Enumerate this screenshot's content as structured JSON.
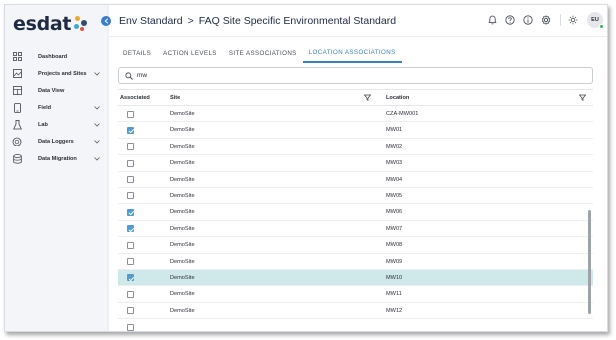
{
  "brand": {
    "name": "esdat",
    "dot_colors": [
      "#f5a623",
      "#2c4a7a",
      "#3aa8d8",
      "#e8523b"
    ]
  },
  "sidebar": {
    "items": [
      {
        "label": "Dashboard",
        "icon": "grid-icon",
        "has_chevron": false
      },
      {
        "label": "Projects and Sites",
        "icon": "map-icon",
        "has_chevron": true
      },
      {
        "label": "Data View",
        "icon": "table-icon",
        "has_chevron": false
      },
      {
        "label": "Field",
        "icon": "mobile-icon",
        "has_chevron": true
      },
      {
        "label": "Lab",
        "icon": "flask-icon",
        "has_chevron": true
      },
      {
        "label": "Data Loggers",
        "icon": "gauge-icon",
        "has_chevron": true
      },
      {
        "label": "Data Migration",
        "icon": "database-icon",
        "has_chevron": true
      }
    ]
  },
  "header": {
    "breadcrumb_root": "Env Standard",
    "breadcrumb_sep": ">",
    "breadcrumb_current": "FAQ Site Specific Environmental Standard",
    "avatar_initials": "EU",
    "icons": [
      "bell-icon",
      "help-icon",
      "info-icon",
      "settings-icon",
      "theme-icon"
    ]
  },
  "tabs": [
    {
      "label": "DETAILS",
      "active": false
    },
    {
      "label": "ACTION LEVELS",
      "active": false
    },
    {
      "label": "SITE ASSOCIATIONS",
      "active": false
    },
    {
      "label": "LOCATION ASSOCIATIONS",
      "active": true
    }
  ],
  "search": {
    "value": "mw",
    "placeholder": ""
  },
  "grid": {
    "columns": {
      "associated": "Associated",
      "site": "Site",
      "location": "Location"
    },
    "rows": [
      {
        "associated": false,
        "site": "DemoSite",
        "location": "CZA-MW001",
        "selected": false
      },
      {
        "associated": true,
        "site": "DemoSite",
        "location": "MW01",
        "selected": false
      },
      {
        "associated": false,
        "site": "DemoSite",
        "location": "MW02",
        "selected": false
      },
      {
        "associated": false,
        "site": "DemoSite",
        "location": "MW03",
        "selected": false
      },
      {
        "associated": false,
        "site": "DemoSite",
        "location": "MW04",
        "selected": false
      },
      {
        "associated": false,
        "site": "DemoSite",
        "location": "MW05",
        "selected": false
      },
      {
        "associated": true,
        "site": "DemoSite",
        "location": "MW06",
        "selected": false
      },
      {
        "associated": true,
        "site": "DemoSite",
        "location": "MW07",
        "selected": false
      },
      {
        "associated": false,
        "site": "DemoSite",
        "location": "MW08",
        "selected": false
      },
      {
        "associated": false,
        "site": "DemoSite",
        "location": "MW09",
        "selected": false
      },
      {
        "associated": true,
        "site": "DemoSite",
        "location": "MW10",
        "selected": true
      },
      {
        "associated": false,
        "site": "DemoSite",
        "location": "MW11",
        "selected": false
      },
      {
        "associated": false,
        "site": "DemoSite",
        "location": "MW12",
        "selected": false
      },
      {
        "associated": false,
        "site": "",
        "location": "",
        "selected": false
      }
    ]
  },
  "colors": {
    "accent": "#3a83b8",
    "selected_row": "#cfe8ea",
    "checkbox_checked": "#4e9bd6"
  }
}
